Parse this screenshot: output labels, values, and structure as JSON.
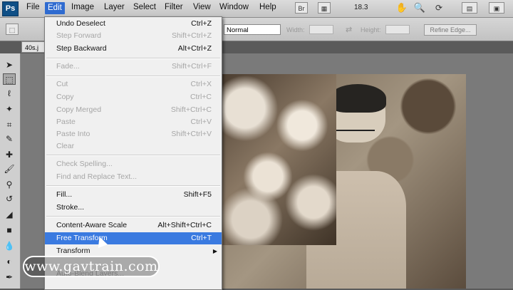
{
  "app": {
    "logo": "Ps"
  },
  "menubar": {
    "items": [
      "File",
      "Edit",
      "Image",
      "Layer",
      "Select",
      "Filter",
      "View",
      "Window",
      "Help"
    ],
    "active": "Edit",
    "bridge_label": "Br",
    "zoom": "18.3"
  },
  "options": {
    "style_value": "Normal",
    "width_label": "Width:",
    "height_label": "Height:",
    "refine_label": "Refine Edge..."
  },
  "document": {
    "tab_label": "40s.j"
  },
  "edit_menu": [
    {
      "label": "Undo Deselect",
      "shortcut": "Ctrl+Z",
      "enabled": true
    },
    {
      "label": "Step Forward",
      "shortcut": "Shift+Ctrl+Z",
      "enabled": false
    },
    {
      "label": "Step Backward",
      "shortcut": "Alt+Ctrl+Z",
      "enabled": true
    },
    {
      "label": "Fade...",
      "shortcut": "Shift+Ctrl+F",
      "enabled": false
    },
    {
      "label": "Cut",
      "shortcut": "Ctrl+X",
      "enabled": false
    },
    {
      "label": "Copy",
      "shortcut": "Ctrl+C",
      "enabled": false
    },
    {
      "label": "Copy Merged",
      "shortcut": "Shift+Ctrl+C",
      "enabled": false
    },
    {
      "label": "Paste",
      "shortcut": "Ctrl+V",
      "enabled": false
    },
    {
      "label": "Paste Into",
      "shortcut": "Shift+Ctrl+V",
      "enabled": false
    },
    {
      "label": "Clear",
      "shortcut": "",
      "enabled": false
    },
    {
      "label": "Check Spelling...",
      "shortcut": "",
      "enabled": false
    },
    {
      "label": "Find and Replace Text...",
      "shortcut": "",
      "enabled": false
    },
    {
      "label": "Fill...",
      "shortcut": "Shift+F5",
      "enabled": true
    },
    {
      "label": "Stroke...",
      "shortcut": "",
      "enabled": true
    },
    {
      "label": "Content-Aware Scale",
      "shortcut": "Alt+Shift+Ctrl+C",
      "enabled": true
    },
    {
      "label": "Free Transform",
      "shortcut": "Ctrl+T",
      "enabled": true,
      "highlighted": true
    },
    {
      "label": "Transform",
      "shortcut": "",
      "enabled": true,
      "submenu": true
    },
    {
      "label": "Auto-Blend Layers...",
      "shortcut": "",
      "enabled": false
    }
  ],
  "watermark": {
    "text": "www.gavtrain.com"
  },
  "colors": {
    "menu_highlight": "#3a7ae0",
    "menubar_active": "#2f6bd0",
    "ps_blue": "#0f4f86"
  }
}
